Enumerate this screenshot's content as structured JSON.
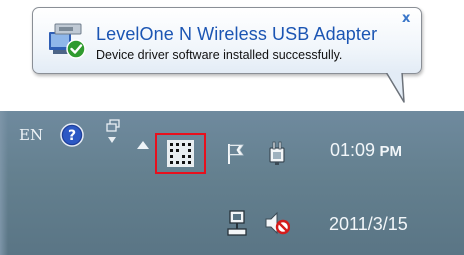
{
  "notification": {
    "title": "LevelOne N Wireless USB Adapter",
    "message": "Device driver software installed successfully.",
    "close_glyph": "x",
    "icon": "device-driver-installed-icon"
  },
  "taskbar": {
    "language": "EN",
    "help_icon": "help-icon",
    "highlighted_icon": "wireless-network-icon",
    "highlight_color": "#e8101d",
    "clock": {
      "time": "01:09",
      "ampm": "PM",
      "date": "2011/3/15"
    },
    "tray_icons": [
      "action-center-flag-icon",
      "power-icon",
      "network-lan-icon",
      "volume-muted-icon"
    ]
  }
}
